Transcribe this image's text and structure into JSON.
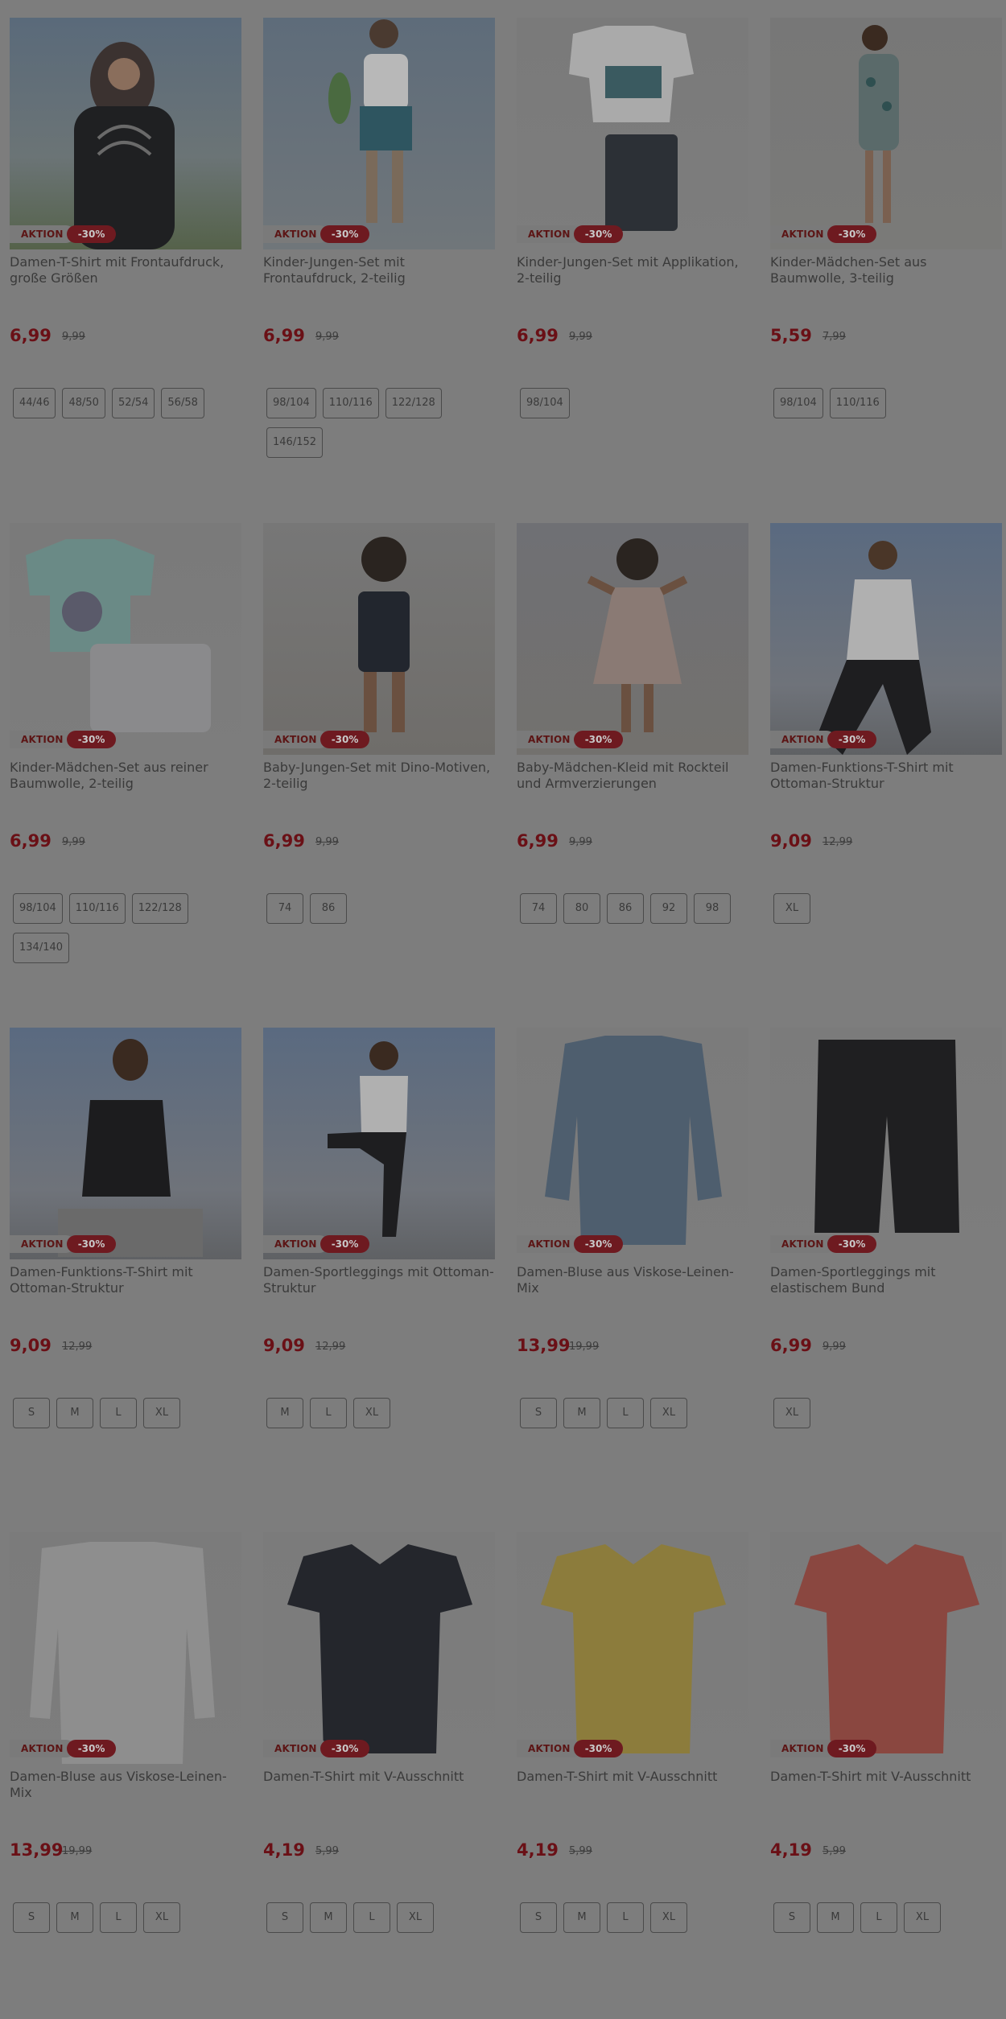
{
  "products": [
    {
      "title": "Damen-T-Shirt mit Frontaufdruck, große Größen",
      "badge": "AKTION",
      "discount": "-30%",
      "price": "6,99",
      "old_price": "9,99",
      "sizes": [
        "44/46",
        "48/50",
        "52/54",
        "56/58"
      ],
      "image": "woman-black-print-tshirt"
    },
    {
      "title": "Kinder-Jungen-Set mit Frontaufdruck, 2-teilig",
      "badge": "AKTION",
      "discount": "-30%",
      "price": "6,99",
      "old_price": "9,99",
      "sizes": [
        "98/104",
        "110/116",
        "122/128",
        "146/152"
      ],
      "image": "boy-shirt-shorts-skateboard"
    },
    {
      "title": "Kinder-Jungen-Set mit Applikation, 2-teilig",
      "badge": "AKTION",
      "discount": "-30%",
      "price": "6,99",
      "old_price": "9,99",
      "sizes": [
        "98/104"
      ],
      "image": "kids-shirt-shorts-product"
    },
    {
      "title": "Kinder-Mädchen-Set aus Baumwolle, 3-teilig",
      "badge": "AKTION",
      "discount": "-30%",
      "price": "5,59",
      "old_price": "7,99",
      "sizes": [
        "98/104",
        "110/116"
      ],
      "image": "girl-leaf-print-set"
    },
    {
      "title": "Kinder-Mädchen-Set aus reiner Baumwolle, 2-teilig",
      "badge": "AKTION",
      "discount": "-30%",
      "price": "6,99",
      "old_price": "9,99",
      "sizes": [
        "98/104",
        "110/116",
        "122/128",
        "134/140"
      ],
      "image": "girl-mint-shirt-shorts"
    },
    {
      "title": "Baby-Jungen-Set mit Dino-Motiven, 2-teilig",
      "badge": "AKTION",
      "discount": "-30%",
      "price": "6,99",
      "old_price": "9,99",
      "sizes": [
        "74",
        "86"
      ],
      "image": "baby-boy-dungarees"
    },
    {
      "title": "Baby-Mädchen-Kleid mit Rockteil und Armverzierungen",
      "badge": "AKTION",
      "discount": "-30%",
      "price": "6,99",
      "old_price": "9,99",
      "sizes": [
        "74",
        "80",
        "86",
        "92",
        "98"
      ],
      "image": "baby-girl-dress"
    },
    {
      "title": "Damen-Funktions-T-Shirt mit Ottoman-Struktur",
      "badge": "AKTION",
      "discount": "-30%",
      "price": "9,09",
      "old_price": "12,99",
      "sizes": [
        "XL"
      ],
      "image": "woman-white-sport-shirt"
    },
    {
      "title": "Damen-Funktions-T-Shirt mit Ottoman-Struktur",
      "badge": "AKTION",
      "discount": "-30%",
      "price": "9,09",
      "old_price": "12,99",
      "sizes": [
        "S",
        "M",
        "L",
        "XL"
      ],
      "image": "woman-black-sport-shirt"
    },
    {
      "title": "Damen-Sportleggings mit Ottoman-Struktur",
      "badge": "AKTION",
      "discount": "-30%",
      "price": "9,09",
      "old_price": "12,99",
      "sizes": [
        "M",
        "L",
        "XL"
      ],
      "image": "woman-sport-leggings"
    },
    {
      "title": "Damen-Bluse aus Viskose-Leinen-Mix",
      "badge": "AKTION",
      "discount": "-30%",
      "price": "13,99",
      "old_price": "19,99",
      "sizes": [
        "S",
        "M",
        "L",
        "XL"
      ],
      "image": "blue-blouse"
    },
    {
      "title": "Damen-Sportleggings mit elastischem Bund",
      "badge": "AKTION",
      "discount": "-30%",
      "price": "6,99",
      "old_price": "9,99",
      "sizes": [
        "XL"
      ],
      "image": "black-bike-shorts"
    },
    {
      "title": "Damen-Bluse aus Viskose-Leinen-Mix",
      "badge": "AKTION",
      "discount": "-30%",
      "price": "13,99",
      "old_price": "19,99",
      "sizes": [
        "S",
        "M",
        "L",
        "XL"
      ],
      "image": "white-blouse"
    },
    {
      "title": "Damen-T-Shirt mit V-Ausschnitt",
      "badge": "AKTION",
      "discount": "-30%",
      "price": "4,19",
      "old_price": "5,99",
      "sizes": [
        "S",
        "M",
        "L",
        "XL"
      ],
      "image": "navy-vneck-tshirt"
    },
    {
      "title": "Damen-T-Shirt mit V-Ausschnitt",
      "badge": "AKTION",
      "discount": "-30%",
      "price": "4,19",
      "old_price": "5,99",
      "sizes": [
        "S",
        "M",
        "L",
        "XL"
      ],
      "image": "yellow-vneck-tshirt"
    },
    {
      "title": "Damen-T-Shirt mit V-Ausschnitt",
      "badge": "AKTION",
      "discount": "-30%",
      "price": "4,19",
      "old_price": "5,99",
      "sizes": [
        "S",
        "M",
        "L",
        "XL"
      ],
      "image": "red-vneck-tshirt"
    }
  ],
  "colors": {
    "overlay": "#7d7d7d",
    "price": "#6a1016",
    "discount_badge": "#6e1a20"
  }
}
